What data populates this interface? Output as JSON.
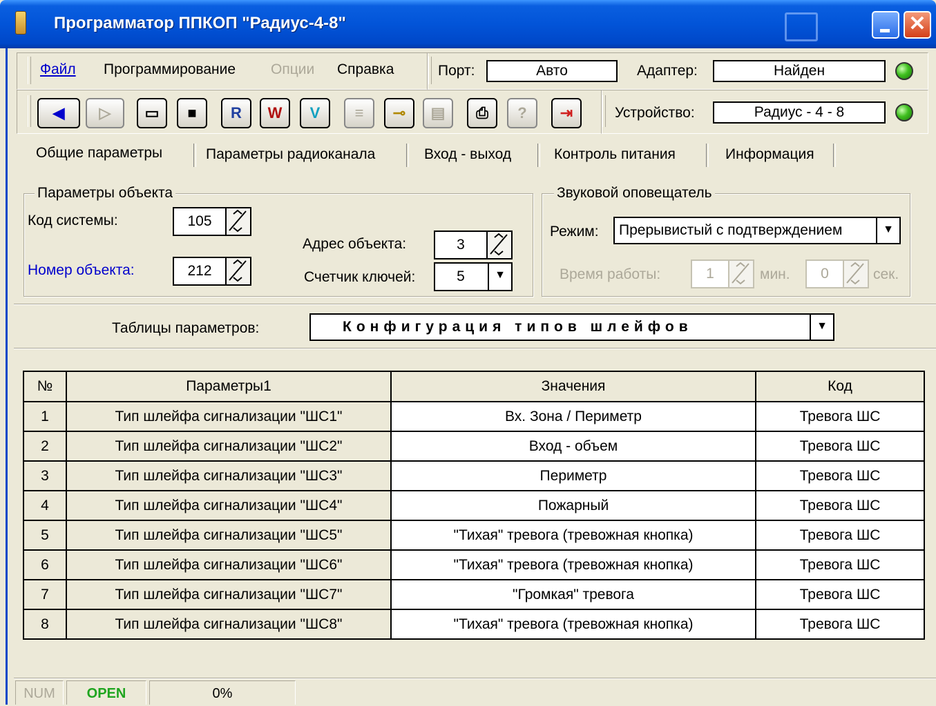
{
  "window": {
    "title": "Программатор ППКОП \"Радиус-4-8\"",
    "close_glyph": "✕"
  },
  "menu": {
    "file": "Файл",
    "programming": "Программирование",
    "options": "Опции",
    "help": "Справка"
  },
  "connection": {
    "port_label": "Порт:",
    "port_value": "Авто",
    "adapter_label": "Адаптер:",
    "adapter_value": "Найден",
    "device_label": "Устройство:",
    "device_value": "Радиус - 4 - 8",
    "led_color": "#40c020"
  },
  "toolbar": {
    "back_glyph": "◀",
    "forward_glyph": "▷",
    "open_glyph": "▭",
    "save_glyph": "■",
    "read_glyph": "R",
    "write_glyph": "W",
    "verify_glyph": "V",
    "list_glyph": "≡",
    "key_glyph": "⊸",
    "doc_glyph": "▤",
    "print_glyph": "⎙",
    "help_glyph": "?",
    "exit_glyph": "⇥"
  },
  "tabs": [
    "Общие  параметры",
    "Параметры радиоканала",
    "Вход - выход",
    "Контроль питания",
    "Информация"
  ],
  "object_params": {
    "title": "Параметры объекта",
    "system_code_label": "Код системы:",
    "system_code_value": "105",
    "object_number_label": "Номер объекта:",
    "object_number_value": "212",
    "object_address_label": "Адрес объекта:",
    "object_address_value": "3",
    "key_counter_label": "Счетчик ключей:",
    "key_counter_value": "5"
  },
  "sounder": {
    "title": "Звуковой оповещатель",
    "mode_label": "Режим:",
    "mode_value": "Прерывистый с подтверждением",
    "work_time_label": "Время работы:",
    "minutes_value": "1",
    "minutes_unit": "мин.",
    "seconds_value": "0",
    "seconds_unit": "сек."
  },
  "tables": {
    "label": "Таблицы  параметров:",
    "selected": "Конфигурация типов шлейфов"
  },
  "grid": {
    "headers": [
      "№",
      "Параметры1",
      "Значения",
      "Код"
    ],
    "rows": [
      [
        "1",
        "Тип шлейфа сигнализации  \"ШС1\"",
        "Вх. Зона / Периметр",
        "Тревога ШС"
      ],
      [
        "2",
        "Тип шлейфа сигнализации  \"ШС2\"",
        "Вход - объем",
        "Тревога ШС"
      ],
      [
        "3",
        "Тип шлейфа сигнализации  \"ШС3\"",
        "Периметр",
        "Тревога ШС"
      ],
      [
        "4",
        "Тип шлейфа сигнализации  \"ШС4\"",
        "Пожарный",
        "Тревога ШС"
      ],
      [
        "5",
        "Тип шлейфа сигнализации  \"ШС5\"",
        "\"Тихая\" тревога (тревожная кнопка)",
        "Тревога ШС"
      ],
      [
        "6",
        "Тип шлейфа сигнализации  \"ШС6\"",
        "\"Тихая\" тревога (тревожная кнопка)",
        "Тревога ШС"
      ],
      [
        "7",
        "Тип шлейфа сигнализации  \"ШС7\"",
        "\"Громкая\" тревога",
        "Тревога ШС"
      ],
      [
        "8",
        "Тип шлейфа сигнализации  \"ШС8\"",
        "\"Тихая\" тревога (тревожная кнопка)",
        "Тревога ШС"
      ]
    ]
  },
  "status": {
    "num": "NUM",
    "open": "OPEN",
    "open_color": "#1fa51f",
    "progress": "0%"
  }
}
